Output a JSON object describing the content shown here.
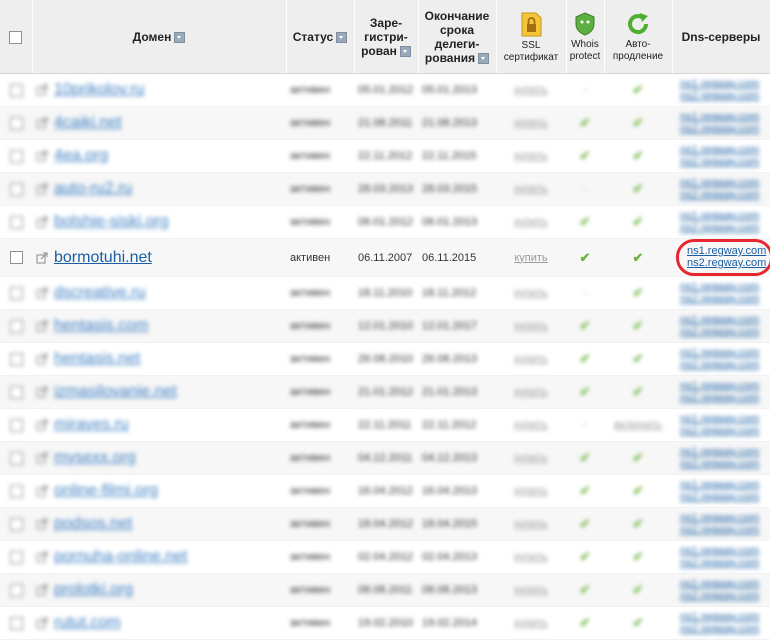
{
  "header": {
    "domain": "Домен",
    "status": "Статус",
    "registered": [
      "Заре-",
      "гистри-",
      "рован"
    ],
    "expiry": [
      "Окончание",
      "срока",
      "делеги-",
      "рования"
    ],
    "ssl": [
      "SSL",
      "сертификат"
    ],
    "whois": [
      "Whois",
      "protect"
    ],
    "auto": [
      "Авто-",
      "продление"
    ],
    "dns": "Dns-серверы"
  },
  "icons": {
    "ssl": "ssl-lock-icon",
    "whois": "shield-icon",
    "auto": "refresh-icon"
  },
  "colors": {
    "link": "#1a5fa3",
    "check": "#6db33f",
    "highlight": "#e8262f"
  },
  "rows": [
    {
      "domain": "10prikolov.ru",
      "status": "активен",
      "reg": "05.01.2012",
      "exp": "05.01.2013",
      "ssl": "купить",
      "whois": "-",
      "auto": "✔",
      "ns1": "ns1.regway.com",
      "ns2": "ns2.regway.com",
      "blurred": true
    },
    {
      "domain": "4caiki.net",
      "status": "активен",
      "reg": "21.08.2011",
      "exp": "21.08.2013",
      "ssl": "купить",
      "whois": "✔",
      "auto": "✔",
      "ns1": "ns1.regway.com",
      "ns2": "ns2.regway.com",
      "blurred": true
    },
    {
      "domain": "4ea.org",
      "status": "активен",
      "reg": "22.11.2012",
      "exp": "22.11.2015",
      "ssl": "купить",
      "whois": "✔",
      "auto": "✔",
      "ns1": "ns1.regway.com",
      "ns2": "ns2.regway.com",
      "blurred": true
    },
    {
      "domain": "auto-ru2.ru",
      "status": "активен",
      "reg": "28.03.2013",
      "exp": "28.03.2015",
      "ssl": "купить",
      "whois": "-",
      "auto": "✔",
      "ns1": "ns1.regway.com",
      "ns2": "ns2.regway.com",
      "blurred": true
    },
    {
      "domain": "bolshie-siski.org",
      "status": "активен",
      "reg": "06.01.2012",
      "exp": "06.01.2013",
      "ssl": "купить",
      "whois": "✔",
      "auto": "✔",
      "ns1": "ns1.regway.com",
      "ns2": "ns2.regway.com",
      "blurred": true
    },
    {
      "domain": "bormotuhi.net",
      "status": "активен",
      "reg": "06.11.2007",
      "exp": "06.11.2015",
      "ssl": "купить",
      "whois": "✔",
      "auto": "✔",
      "ns1": "ns1.regway.com",
      "ns2": "ns2.regway.com",
      "blurred": false
    },
    {
      "domain": "dscreative.ru",
      "status": "активен",
      "reg": "18.11.2010",
      "exp": "18.11.2012",
      "ssl": "купить",
      "whois": "-",
      "auto": "✔",
      "ns1": "ns1.regway.com",
      "ns2": "ns2.regway.com",
      "blurred": true
    },
    {
      "domain": "hentasis.com",
      "status": "активен",
      "reg": "12.01.2010",
      "exp": "12.01.2017",
      "ssl": "купить",
      "whois": "✔",
      "auto": "✔",
      "ns1": "ns1.regway.com",
      "ns2": "ns2.regway.com",
      "blurred": true
    },
    {
      "domain": "hentasis.net",
      "status": "активен",
      "reg": "26.08.2010",
      "exp": "26.08.2013",
      "ssl": "купить",
      "whois": "✔",
      "auto": "✔",
      "ns1": "ns1.regway.com",
      "ns2": "ns2.regway.com",
      "blurred": true
    },
    {
      "domain": "izmasilovanie.net",
      "status": "активен",
      "reg": "21.01.2012",
      "exp": "21.01.2013",
      "ssl": "купить",
      "whois": "✔",
      "auto": "✔",
      "ns1": "ns1.regway.com",
      "ns2": "ns2.regway.com",
      "blurred": true
    },
    {
      "domain": "miraves.ru",
      "status": "активен",
      "reg": "22.11.2011",
      "exp": "22.11.2012",
      "ssl": "купить",
      "whois": "-",
      "auto": "включить",
      "ns1": "ns1.regway.com",
      "ns2": "ns2.regway.com",
      "blurred": true
    },
    {
      "domain": "mysexx.org",
      "status": "активен",
      "reg": "04.12.2011",
      "exp": "04.12.2013",
      "ssl": "купить",
      "whois": "✔",
      "auto": "✔",
      "ns1": "ns1.regway.com",
      "ns2": "ns2.regway.com",
      "blurred": true
    },
    {
      "domain": "online-filmi.org",
      "status": "активен",
      "reg": "16.04.2012",
      "exp": "16.04.2013",
      "ssl": "купить",
      "whois": "✔",
      "auto": "✔",
      "ns1": "ns1.regway.com",
      "ns2": "ns2.regway.com",
      "blurred": true
    },
    {
      "domain": "podsos.net",
      "status": "активен",
      "reg": "18.04.2012",
      "exp": "18.04.2015",
      "ssl": "купить",
      "whois": "✔",
      "auto": "✔",
      "ns1": "ns1.regway.com",
      "ns2": "ns2.regway.com",
      "blurred": true
    },
    {
      "domain": "pornuha-online.net",
      "status": "активен",
      "reg": "02.04.2012",
      "exp": "02.04.2013",
      "ssl": "купить",
      "whois": "✔",
      "auto": "✔",
      "ns1": "ns1.regway.com",
      "ns2": "ns2.regway.com",
      "blurred": true
    },
    {
      "domain": "prolotki.org",
      "status": "активен",
      "reg": "08.08.2011",
      "exp": "08.08.2013",
      "ssl": "купить",
      "whois": "✔",
      "auto": "✔",
      "ns1": "ns1.regway.com",
      "ns2": "ns2.regway.com",
      "blurred": true
    },
    {
      "domain": "rutut.com",
      "status": "активен",
      "reg": "19.02.2010",
      "exp": "19.02.2014",
      "ssl": "купить",
      "whois": "✔",
      "auto": "✔",
      "ns1": "ns1.regway.com",
      "ns2": "ns2.regway.com",
      "blurred": true
    }
  ]
}
